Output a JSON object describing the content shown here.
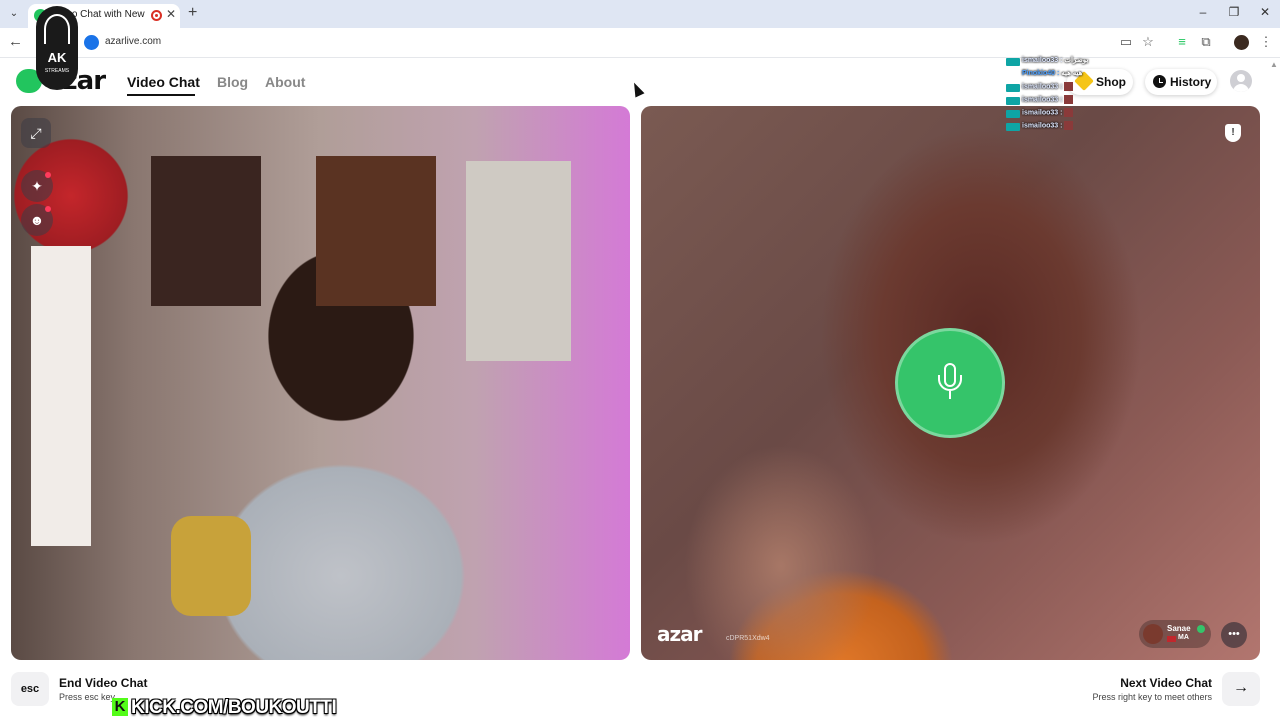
{
  "browser": {
    "tab_title": "Video Chat with New",
    "url": "azarlive.com"
  },
  "site": {
    "logo_text": "azar",
    "nav": [
      {
        "label": "Video Chat"
      },
      {
        "label": "Blog"
      },
      {
        "label": "About"
      }
    ],
    "shop_label": "Shop",
    "history_label": "History"
  },
  "partner_panel": {
    "watermark": "azar",
    "session_code": "cDPR51Xdw4",
    "partner_name": "Sanae",
    "partner_country": "MA"
  },
  "controls": {
    "esc_key": "esc",
    "end_title": "End Video Chat",
    "end_sub": "Press esc key",
    "next_title": "Next Video Chat",
    "next_sub": "Press right key to meet others",
    "next_key_icon": "arrow-right-icon"
  },
  "stream_overlay": {
    "kick_letter": "K",
    "kick_text": "KICK.COM/BOUKOUTTI",
    "logo_ak": "AK",
    "logo_sub": "STREAMS",
    "chat": [
      {
        "user": "ismailoo33 :",
        "message": "بوضرات",
        "blue": false
      },
      {
        "user": "Pinokio40 :",
        "message": "هيه هيه",
        "blue": true
      },
      {
        "user": "ismailoo33 :",
        "message": "",
        "blue": false
      },
      {
        "user": "ismailoo33 :",
        "message": "",
        "blue": false
      },
      {
        "user": "ismailoo33 :",
        "message": "",
        "blue": false
      },
      {
        "user": "ismailoo33 :",
        "message": "",
        "blue": false
      }
    ]
  },
  "colors": {
    "brand_green": "#22c55e",
    "mic_green": "#35c46a",
    "kick_green": "#53fc18"
  }
}
